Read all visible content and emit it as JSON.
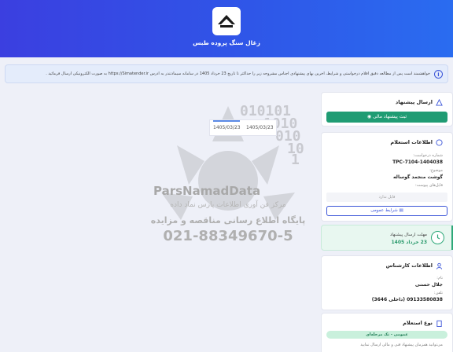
{
  "header": {
    "company": "زغال سنگ پروده طبس"
  },
  "notice": {
    "text": "خواهشمند است پس از مطالعه دقیق اقلام درخواستی و شرایط، آخرین بهای پیشنهادی اجناس مشروحه زیر را حداکثر تا تاریخ 23 خرداد 1405 در سامانه سیمادتندر به آدرس https://Simatender.ir به صورت الکترونیکی ارسال فرمائید ."
  },
  "dates": [
    "1405/03/23",
    "1405/03/23"
  ],
  "watermark": {
    "brand": "ParsNamadData",
    "line1": "مرکز فن آوری اطلاعات پارس نماد داده",
    "line2": "پایگاه اطلاع رسانی مناقصه و مزایده",
    "phone": "021-88349670-5",
    "digits": [
      "010101",
      "1010",
      "010",
      "10",
      "1"
    ]
  },
  "offer": {
    "title": "ارسال پیشنهاد",
    "button": "ثبت پیشنهاد مالی"
  },
  "inquiry": {
    "title": "اطلاعات استعلام",
    "number_label": "شماره درخواست:",
    "number_value": "TPC-7104-1404038",
    "subject_label": "موضوع:",
    "subject_value": "گوشت منجمد گوساله",
    "files_label": "فایل‌های پیوست:",
    "files_empty": "فایل ندارد",
    "conditions_button": "شرایط عمومی"
  },
  "deadline": {
    "label": "مهلت ارسال پیشنهاد",
    "value": "23 خرداد 1405"
  },
  "expert": {
    "title": "اطلاعات کارشناس",
    "name_label": "نام:",
    "name_value": "جلال حسنی",
    "phone_label": "تلفن:",
    "phone_value": "09133580838 (داخلی 3646)"
  },
  "inquiry_type": {
    "title": "نوع استعلام",
    "badge": "عمومی - تک مرحله‌ای",
    "note": "می‌توانید همزمان پیشنهاد فنی و مالی ارسال نمایید"
  },
  "colors": {
    "header": "#2f56e8",
    "primary": "#3b55d8",
    "success": "#1f9c73"
  }
}
